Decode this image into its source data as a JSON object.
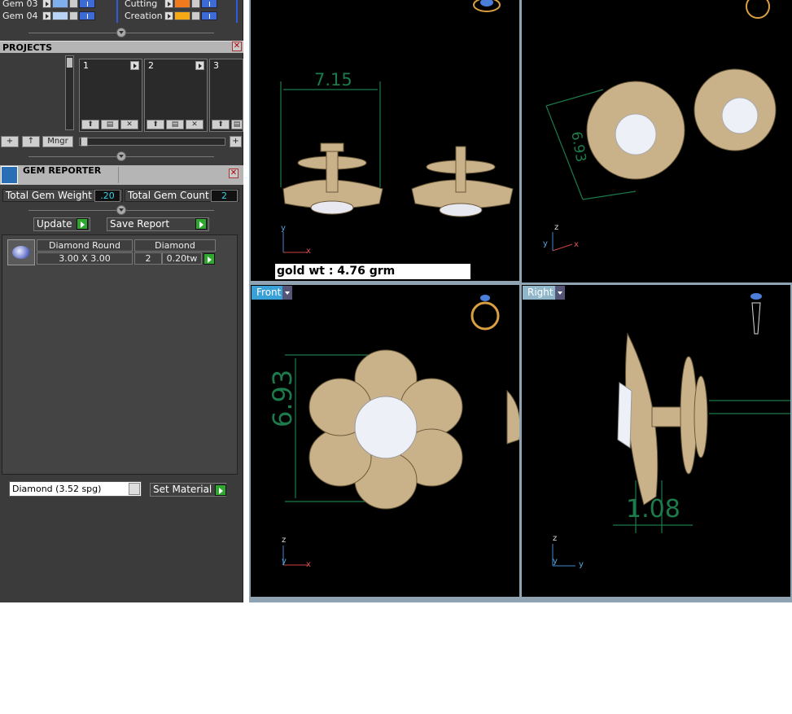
{
  "layers": [
    {
      "name": "Gem 03",
      "color": "#7fb0ee"
    },
    {
      "name": "Gem 04",
      "color": "#b7d3f5"
    },
    {
      "name": "Cutting",
      "color": "#f07a1c"
    },
    {
      "name": "Creation",
      "color": "#f7a915"
    }
  ],
  "projects": {
    "title": "PROJECTS",
    "slots": [
      "1",
      "2",
      "3"
    ],
    "mngr_label": "Mngr"
  },
  "gem_reporter": {
    "title": "GEM REPORTER",
    "total_weight_label": "Total Gem Weight",
    "total_weight_value": ".20",
    "total_count_label": "Total Gem Count",
    "total_count_value": "2",
    "update_label": "Update",
    "save_report_label": "Save Report",
    "row": {
      "shape": "Diamond Round",
      "material": "Diamond",
      "size": "3.00 X 3.00",
      "count": "2",
      "weight": "0.20tw"
    },
    "material_select": "Diamond    (3.52 spg)",
    "set_material_label": "Set Material"
  },
  "views": {
    "top_left": {
      "gold_weight": "gold wt : 4.76 grm",
      "dimension": "7.15"
    },
    "top_right": {
      "dimension": "6.93"
    },
    "front": {
      "label": "Front",
      "label_color": "#3aa0d8",
      "dimension": "6.93"
    },
    "right": {
      "label": "Right",
      "label_color": "#8fb7c9",
      "dimension": "1.08"
    }
  },
  "axes": {
    "x": "x",
    "y": "y",
    "z": "z"
  }
}
